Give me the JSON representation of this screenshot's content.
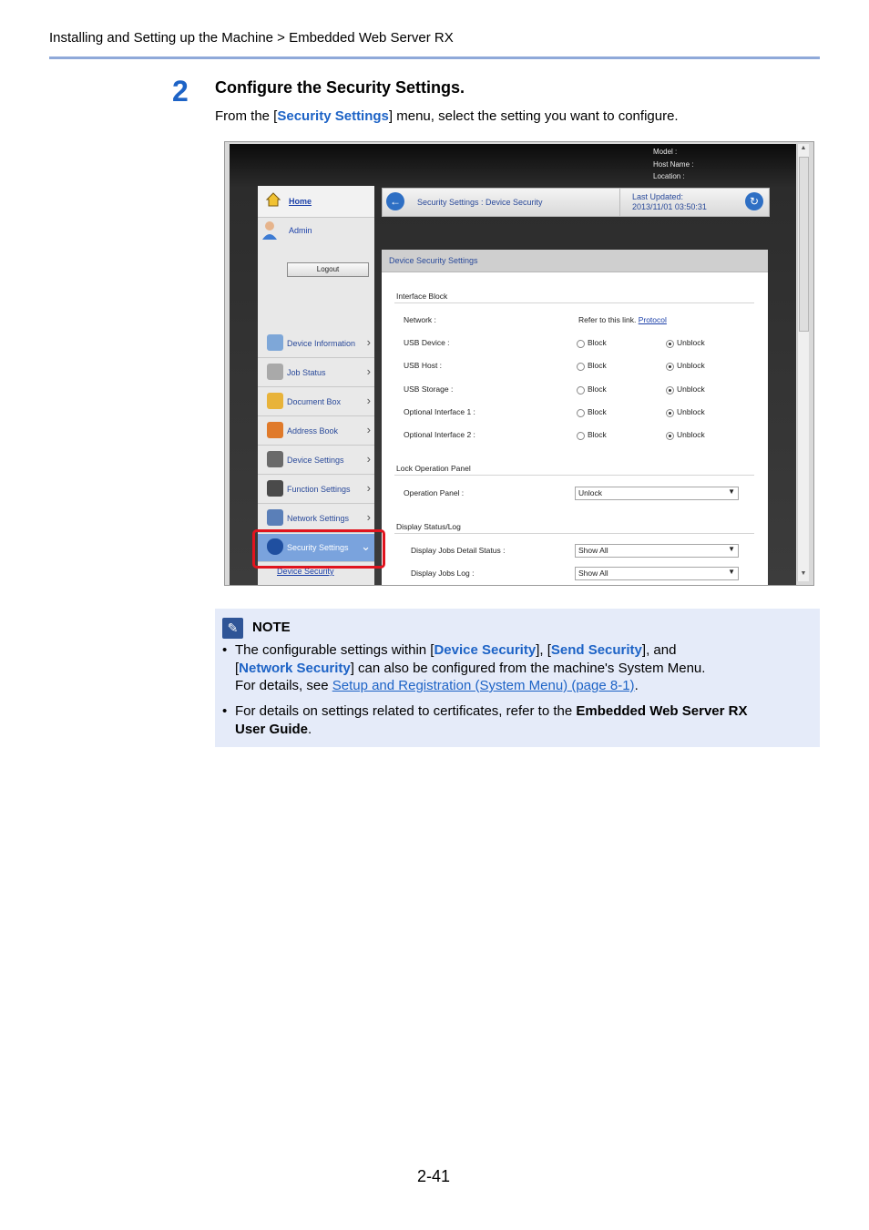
{
  "header": {
    "breadcrumb": "Installing and Setting up the Machine > Embedded Web Server RX"
  },
  "step": {
    "number": "2",
    "title": "Configure the Security Settings.",
    "desc_before": "From the [",
    "desc_term": "Security Settings",
    "desc_after": "] menu, select the setting you want to configure."
  },
  "screenshot": {
    "model_info": [
      "Model :",
      "Host Name :",
      "Location :"
    ],
    "sidebar": {
      "home": "Home",
      "admin": "Admin",
      "logout": "Logout",
      "items": [
        "Device Information",
        "Job Status",
        "Document Box",
        "Address Book",
        "Device Settings",
        "Function Settings",
        "Network Settings",
        "Security Settings"
      ],
      "sub_item": "Device Security"
    },
    "topbar": {
      "breadcrumb": "Security Settings : Device Security",
      "last_updated_label": "Last Updated:",
      "last_updated_value": "2013/11/01 03:50:31"
    },
    "panel": {
      "title": "Device Security Settings",
      "interface_block": "Interface Block",
      "network_label": "Network :",
      "network_text": "Refer to this link.",
      "network_link": "Protocol",
      "block_label": "Block",
      "unblock_label": "Unblock",
      "interfaces": [
        "USB Device :",
        "USB Host :",
        "USB Storage :",
        "Optional Interface 1 :",
        "Optional Interface 2 :"
      ],
      "lock_section": "Lock Operation Panel",
      "operation_panel_label": "Operation Panel :",
      "operation_panel_value": "Unlock",
      "display_section": "Display Status/Log",
      "jobs_detail_label": "Display Jobs Detail Status :",
      "jobs_detail_value": "Show All",
      "jobs_log_label": "Display Jobs Log :",
      "jobs_log_value": "Show All"
    }
  },
  "note": {
    "title": "NOTE",
    "b1_t1": "The configurable settings within [",
    "b1_k1": "Device Security",
    "b1_t2": "], [",
    "b1_k2": "Send Security",
    "b1_t3": "], and",
    "b1_t4": "[",
    "b1_k3": "Network Security",
    "b1_t5": "] can also be configured from the machine's System Menu.",
    "b1_t6": "For details, see ",
    "b1_link": "Setup and Registration (System Menu) (page 8-1)",
    "b1_t7": ".",
    "b2_t1": "For details on settings related to certificates, refer to the ",
    "b2_bold1": "Embedded Web Server RX",
    "b2_bold2": "User Guide",
    "b2_t2": "."
  },
  "footer": {
    "page_number": "2-41"
  },
  "colors": {
    "accent": "#1d63c6",
    "highlight": "#e0141e",
    "note_bg": "#e5ebf9",
    "rule": "#8fa9d9"
  }
}
